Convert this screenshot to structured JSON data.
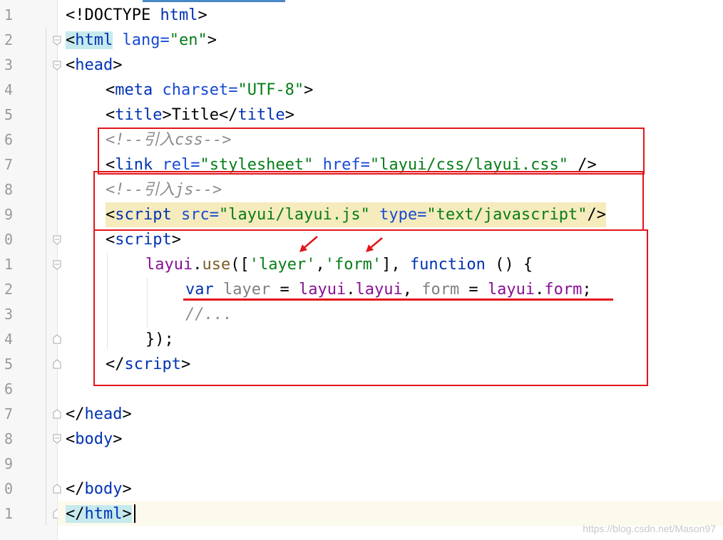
{
  "gutter": {
    "line_numbers": [
      "1",
      "2",
      "3",
      "4",
      "5",
      "6",
      "7",
      "8",
      "9",
      "0",
      "1",
      "2",
      "3",
      "4",
      "5",
      "6",
      "7",
      "8",
      "9",
      "0",
      "1"
    ]
  },
  "code": {
    "l1": {
      "a": "<!DOCTYPE ",
      "b": "html",
      "c": ">"
    },
    "l2": {
      "a": "<",
      "b": "html",
      "c": " lang=",
      "d": "\"en\"",
      "e": ">"
    },
    "l3": {
      "a": "<",
      "b": "head",
      "c": ">"
    },
    "l4": {
      "a": "<",
      "b": "meta",
      "c": " charset=",
      "d": "\"UTF-8\"",
      "e": ">"
    },
    "l5": {
      "a": "<",
      "b": "title",
      "c": ">Title</",
      "d": "title",
      "e": ">"
    },
    "l6": {
      "a": "<!--引入css-->"
    },
    "l7": {
      "a": "<",
      "b": "link",
      "c": " rel=",
      "d": "\"stylesheet\"",
      "e": " href=",
      "f": "\"layui/css/layui.css\"",
      "g": " />"
    },
    "l8": {
      "a": "<!--引入js-->"
    },
    "l9": {
      "a": "<",
      "b": "script",
      "c": " src=",
      "d": "\"layui/layui.js\"",
      "e": " type=",
      "f": "\"text/javascript\"",
      "g": "/>"
    },
    "l10": {
      "a": "<",
      "b": "script",
      "c": ">"
    },
    "l11": {
      "a": "layui",
      "b": ".",
      "c": "use",
      "d": "([",
      "e": "'layer'",
      "f": ",",
      "g": "'form'",
      "h": "], ",
      "i": "function",
      "j": " () {"
    },
    "l12": {
      "a": "var",
      "b": " ",
      "c": "layer",
      "d": " = ",
      "e": "layui",
      "f": ".",
      "g": "layui",
      "h": ", ",
      "i": "form",
      "j": " = ",
      "k": "layui",
      "l": ".",
      "m": "form",
      "n": ";"
    },
    "l13": {
      "a": "//..."
    },
    "l14": {
      "a": "});"
    },
    "l15": {
      "a": "</",
      "b": "script",
      "c": ">"
    },
    "l17": {
      "a": "</",
      "b": "head",
      "c": ">"
    },
    "l18": {
      "a": "<",
      "b": "body",
      "c": ">"
    },
    "l20": {
      "a": "</",
      "b": "body",
      "c": ">"
    },
    "l21": {
      "a": "</",
      "b": "html",
      "c": ">"
    }
  },
  "watermark": "https://blog.csdn.net/Mason97",
  "colors": {
    "tag": "#0033b3",
    "string": "#067d17",
    "comment": "#8c8c8c",
    "identifier": "#871094",
    "annotation": "#e3151a",
    "brace_match": "#c6e9ed"
  }
}
